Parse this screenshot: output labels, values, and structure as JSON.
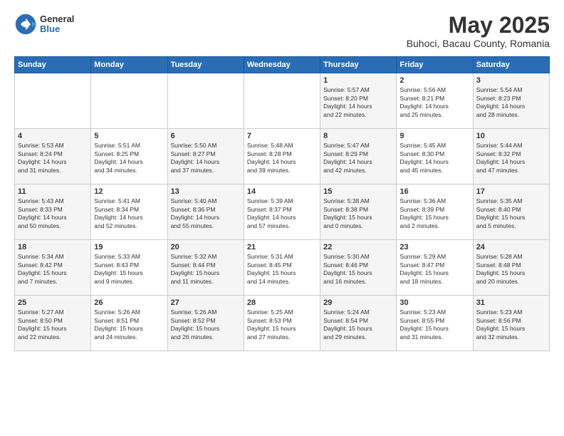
{
  "header": {
    "logo_general": "General",
    "logo_blue": "Blue",
    "title": "May 2025",
    "subtitle": "Buhoci, Bacau County, Romania"
  },
  "weekdays": [
    "Sunday",
    "Monday",
    "Tuesday",
    "Wednesday",
    "Thursday",
    "Friday",
    "Saturday"
  ],
  "weeks": [
    [
      {
        "day": "",
        "info": ""
      },
      {
        "day": "",
        "info": ""
      },
      {
        "day": "",
        "info": ""
      },
      {
        "day": "",
        "info": ""
      },
      {
        "day": "1",
        "info": "Sunrise: 5:57 AM\nSunset: 8:20 PM\nDaylight: 14 hours\nand 22 minutes."
      },
      {
        "day": "2",
        "info": "Sunrise: 5:56 AM\nSunset: 8:21 PM\nDaylight: 14 hours\nand 25 minutes."
      },
      {
        "day": "3",
        "info": "Sunrise: 5:54 AM\nSunset: 8:23 PM\nDaylight: 14 hours\nand 28 minutes."
      }
    ],
    [
      {
        "day": "4",
        "info": "Sunrise: 5:53 AM\nSunset: 8:24 PM\nDaylight: 14 hours\nand 31 minutes."
      },
      {
        "day": "5",
        "info": "Sunrise: 5:51 AM\nSunset: 8:25 PM\nDaylight: 14 hours\nand 34 minutes."
      },
      {
        "day": "6",
        "info": "Sunrise: 5:50 AM\nSunset: 8:27 PM\nDaylight: 14 hours\nand 37 minutes."
      },
      {
        "day": "7",
        "info": "Sunrise: 5:48 AM\nSunset: 8:28 PM\nDaylight: 14 hours\nand 39 minutes."
      },
      {
        "day": "8",
        "info": "Sunrise: 5:47 AM\nSunset: 8:29 PM\nDaylight: 14 hours\nand 42 minutes."
      },
      {
        "day": "9",
        "info": "Sunrise: 5:45 AM\nSunset: 8:30 PM\nDaylight: 14 hours\nand 45 minutes."
      },
      {
        "day": "10",
        "info": "Sunrise: 5:44 AM\nSunset: 8:32 PM\nDaylight: 14 hours\nand 47 minutes."
      }
    ],
    [
      {
        "day": "11",
        "info": "Sunrise: 5:43 AM\nSunset: 8:33 PM\nDaylight: 14 hours\nand 50 minutes."
      },
      {
        "day": "12",
        "info": "Sunrise: 5:41 AM\nSunset: 8:34 PM\nDaylight: 14 hours\nand 52 minutes."
      },
      {
        "day": "13",
        "info": "Sunrise: 5:40 AM\nSunset: 8:36 PM\nDaylight: 14 hours\nand 55 minutes."
      },
      {
        "day": "14",
        "info": "Sunrise: 5:39 AM\nSunset: 8:37 PM\nDaylight: 14 hours\nand 57 minutes."
      },
      {
        "day": "15",
        "info": "Sunrise: 5:38 AM\nSunset: 8:38 PM\nDaylight: 15 hours\nand 0 minutes."
      },
      {
        "day": "16",
        "info": "Sunrise: 5:36 AM\nSunset: 8:39 PM\nDaylight: 15 hours\nand 2 minutes."
      },
      {
        "day": "17",
        "info": "Sunrise: 5:35 AM\nSunset: 8:40 PM\nDaylight: 15 hours\nand 5 minutes."
      }
    ],
    [
      {
        "day": "18",
        "info": "Sunrise: 5:34 AM\nSunset: 8:42 PM\nDaylight: 15 hours\nand 7 minutes."
      },
      {
        "day": "19",
        "info": "Sunrise: 5:33 AM\nSunset: 8:43 PM\nDaylight: 15 hours\nand 9 minutes."
      },
      {
        "day": "20",
        "info": "Sunrise: 5:32 AM\nSunset: 8:44 PM\nDaylight: 15 hours\nand 11 minutes."
      },
      {
        "day": "21",
        "info": "Sunrise: 5:31 AM\nSunset: 8:45 PM\nDaylight: 15 hours\nand 14 minutes."
      },
      {
        "day": "22",
        "info": "Sunrise: 5:30 AM\nSunset: 8:46 PM\nDaylight: 15 hours\nand 16 minutes."
      },
      {
        "day": "23",
        "info": "Sunrise: 5:29 AM\nSunset: 8:47 PM\nDaylight: 15 hours\nand 18 minutes."
      },
      {
        "day": "24",
        "info": "Sunrise: 5:28 AM\nSunset: 8:48 PM\nDaylight: 15 hours\nand 20 minutes."
      }
    ],
    [
      {
        "day": "25",
        "info": "Sunrise: 5:27 AM\nSunset: 8:50 PM\nDaylight: 15 hours\nand 22 minutes."
      },
      {
        "day": "26",
        "info": "Sunrise: 5:26 AM\nSunset: 8:51 PM\nDaylight: 15 hours\nand 24 minutes."
      },
      {
        "day": "27",
        "info": "Sunrise: 5:26 AM\nSunset: 8:52 PM\nDaylight: 15 hours\nand 26 minutes."
      },
      {
        "day": "28",
        "info": "Sunrise: 5:25 AM\nSunset: 8:53 PM\nDaylight: 15 hours\nand 27 minutes."
      },
      {
        "day": "29",
        "info": "Sunrise: 5:24 AM\nSunset: 8:54 PM\nDaylight: 15 hours\nand 29 minutes."
      },
      {
        "day": "30",
        "info": "Sunrise: 5:23 AM\nSunset: 8:55 PM\nDaylight: 15 hours\nand 31 minutes."
      },
      {
        "day": "31",
        "info": "Sunrise: 5:23 AM\nSunset: 8:56 PM\nDaylight: 15 hours\nand 32 minutes."
      }
    ]
  ]
}
